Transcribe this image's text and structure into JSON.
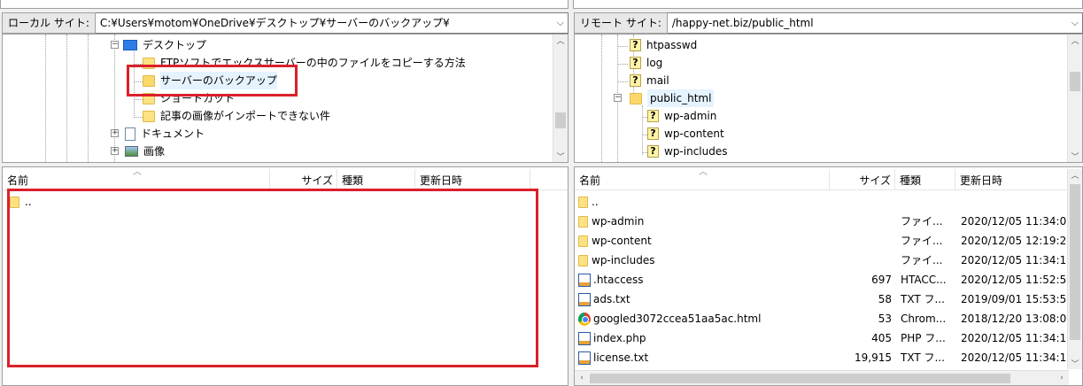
{
  "local": {
    "site_label": "ローカル サイト:",
    "site_path": "C:¥Users¥motom¥OneDrive¥デスクトップ¥サーバーのバックアップ¥",
    "tree": [
      {
        "label": "デスクトップ",
        "icon": "desktop-icon"
      },
      {
        "label": "FTPソフトでエックスサーバーの中のファイルをコピーする方法",
        "icon": "folder-icon"
      },
      {
        "label": "サーバーのバックアップ",
        "icon": "folder-icon"
      },
      {
        "label": "ショートカット",
        "icon": "folder-icon"
      },
      {
        "label": "記事の画像がインポートできない件",
        "icon": "folder-icon"
      },
      {
        "label": "ドキュメント",
        "icon": "document-icon"
      },
      {
        "label": "画像",
        "icon": "picture-icon"
      }
    ],
    "columns": {
      "name": "名前",
      "size": "サイズ",
      "type": "種類",
      "modified": "更新日時"
    },
    "files": [
      {
        "name": "..",
        "icon": "folder-icon"
      }
    ]
  },
  "remote": {
    "site_label": "リモート サイト:",
    "site_path": "/happy-net.biz/public_html",
    "tree": [
      {
        "label": "htpasswd",
        "icon": "unknown-folder-icon"
      },
      {
        "label": "log",
        "icon": "unknown-folder-icon"
      },
      {
        "label": "mail",
        "icon": "unknown-folder-icon"
      },
      {
        "label": "public_html",
        "icon": "folder-icon"
      },
      {
        "label": "wp-admin",
        "icon": "unknown-folder-icon"
      },
      {
        "label": "wp-content",
        "icon": "unknown-folder-icon"
      },
      {
        "label": "wp-includes",
        "icon": "unknown-folder-icon"
      }
    ],
    "columns": {
      "name": "名前",
      "size": "サイズ",
      "type": "種類",
      "modified": "更新日時"
    },
    "files": [
      {
        "name": "..",
        "size": "",
        "type": "",
        "modified": "",
        "icon": "folder-icon"
      },
      {
        "name": "wp-admin",
        "size": "",
        "type": "ファイ...",
        "modified": "2020/12/05 11:34:0",
        "icon": "folder-icon"
      },
      {
        "name": "wp-content",
        "size": "",
        "type": "ファイ...",
        "modified": "2020/12/05 12:19:2",
        "icon": "folder-icon"
      },
      {
        "name": "wp-includes",
        "size": "",
        "type": "ファイ...",
        "modified": "2020/12/05 11:34:1",
        "icon": "folder-icon"
      },
      {
        "name": ".htaccess",
        "size": "697",
        "type": "HTACC...",
        "modified": "2020/12/05 11:52:5",
        "icon": "text-file-icon"
      },
      {
        "name": "ads.txt",
        "size": "58",
        "type": "TXT フ...",
        "modified": "2019/09/01 15:53:5",
        "icon": "text-file-icon"
      },
      {
        "name": "googled3072ccea51aa5ac.html",
        "size": "53",
        "type": "Chrom...",
        "modified": "2018/12/20 13:08:0",
        "icon": "chrome-icon"
      },
      {
        "name": "index.php",
        "size": "405",
        "type": "PHP フ...",
        "modified": "2020/12/05 11:34:1",
        "icon": "php-file-icon"
      },
      {
        "name": "license.txt",
        "size": "19,915",
        "type": "TXT フ...",
        "modified": "2020/12/05 11:34:1",
        "icon": "text-file-icon"
      }
    ]
  },
  "colors": {
    "highlight": "#d9212b",
    "folder": "#fde283"
  }
}
